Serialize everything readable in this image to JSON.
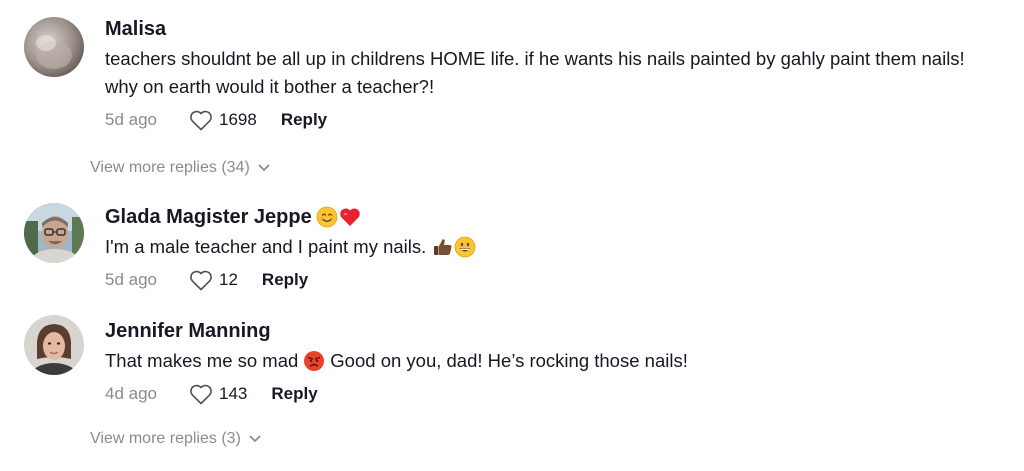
{
  "comments": [
    {
      "name": "Malisa",
      "text": "teachers shouldnt be all up in childrens HOME life. if he wants his nails painted by gahly paint them nails! why on earth would it bother a teacher?!",
      "time": "5d ago",
      "likes": "1698",
      "reply_label": "Reply"
    },
    {
      "name": "Glada Magister Jeppe",
      "text": "I'm a male teacher and I paint my nails.",
      "time": "5d ago",
      "likes": "12",
      "reply_label": "Reply"
    },
    {
      "name": "Jennifer Manning",
      "text_before": "That makes me so mad",
      "text_after": "Good on you, dad! He’s rocking those nails!",
      "time": "4d ago",
      "likes": "143",
      "reply_label": "Reply"
    }
  ],
  "view_more": [
    {
      "label": "View more replies (34)"
    },
    {
      "label": "View more replies (3)"
    }
  ],
  "icons": {
    "like": "heart-outline-icon",
    "expand": "chevron-down-icon"
  },
  "colors": {
    "text": "#161823",
    "muted": "#8a8b91",
    "background": "#ffffff"
  }
}
